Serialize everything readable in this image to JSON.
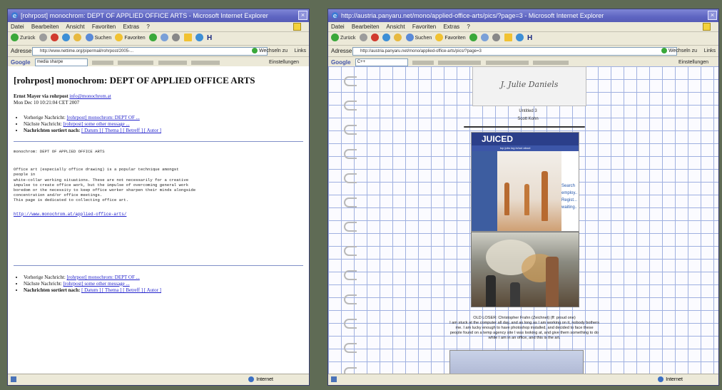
{
  "left_window": {
    "title": "[rohrpost] monochrom: DEPT OF APPLIED OFFICE ARTS - Microsoft Internet Explorer",
    "menu": [
      "Datei",
      "Bearbeiten",
      "Ansicht",
      "Favoriten",
      "Extras",
      "?"
    ],
    "toolbar": [
      "Zurück",
      "Suchen",
      "Favoriten"
    ],
    "address_label": "Adresse",
    "address_value": "http://www.nettime.org/pipermail/rohrpost/2005-...",
    "go_label": "Wechseln zu",
    "links_label": "Links",
    "google_search_value": "media sharpe",
    "google_settings": "Einstellungen",
    "page": {
      "heading": "[rohrpost] monochrom: DEPT OF APPLIED OFFICE ARTS",
      "author_line": "Ernst Mayer via rohrpost",
      "author_link": "info@monochrom.at",
      "date": "Mon Dec 10 10:21:04 CET 2007",
      "nav_top": [
        {
          "label": "Vorherige Nachricht:",
          "link": "[rohrpost] monochrom: DEPT OF ..."
        },
        {
          "label": "Nächste Nachricht:",
          "link": "[rohrpost] some other message ..."
        },
        {
          "label": "Nachrichten sortiert nach:",
          "link": "[ Datum ] [ Thema ] [ Betreff ] [ Autor ]"
        }
      ],
      "message_title": "monochrom: DEPT OF APPLIED OFFICE ARTS",
      "message_body": "Office art (especially office drawing) is a popular technique amongst\npeople in\nwhite-collar working situations. These are not necessarily for a creative\nimpulse to create office work, but the impulse of overcoming general work\nboredom or the necessity to keep office worker sharpen their minds alongside\nconcentration and/or office meetings.\nThis page is dedicated to collecting office art.",
      "message_url": "http://www.monochrom.at/applied-office-arts/",
      "nav_bottom": [
        {
          "label": "Vorherige Nachricht:",
          "link": "[rohrpost] monochrom: DEPT OF ..."
        },
        {
          "label": "Nächste Nachricht:",
          "link": "[rohrpost] some other message ..."
        },
        {
          "label": "Nachrichten sortiert nach:",
          "link": "[ Datum ] [ Thema ] [ Betreff ] [ Autor ]"
        }
      ]
    },
    "status": "Internet"
  },
  "right_window": {
    "title": "http://austria.panyaru.net/mono/applied-office-arts/pics/?page=3 - Microsoft Internet Explorer",
    "menu": [
      "Datei",
      "Bearbeiten",
      "Ansicht",
      "Favoriten",
      "Extras",
      "?"
    ],
    "toolbar": [
      "Zurück",
      "Suchen",
      "Favoriten"
    ],
    "address_label": "Adresse",
    "address_value": "http://austria.panyaru.net/mono/applied-office-arts/pics/?page=3",
    "go_label": "Wechseln zu",
    "links_label": "Links",
    "google_search_value": "C++",
    "google_settings": "Einstellungen",
    "page": {
      "sketch_text": "J. Julie Daniels",
      "caption1": "Untitled 3",
      "caption2": "Scott Kohn",
      "site_logo": "JUICED",
      "site_nav": "top jobs   log in/out   about",
      "site_side": "Search employ... Regist... waiting...",
      "image_caption": "OLD LOSER: Christopher Frahn (Zeichnet) (ff: proud one)",
      "body_text": "I am stuck at the computer all day, and as long as I am working on it, nobody bothers me. I am lucky enough to have photoshop installed, and decided to face these people found on a temp agency site I was looking at, and give them something to do while I am in an office, and this is the art."
    },
    "status": "Internet"
  }
}
